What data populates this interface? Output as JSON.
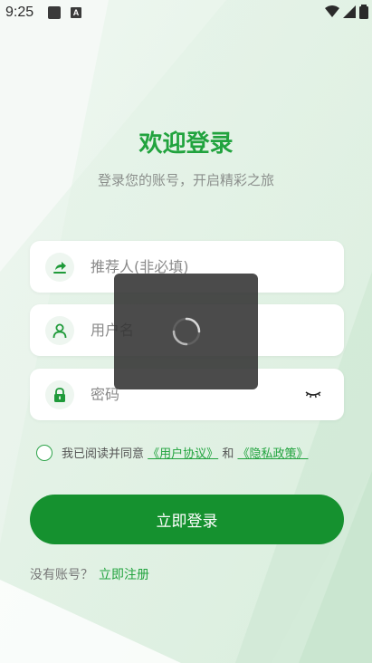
{
  "status_bar": {
    "time": "9:25",
    "app_icon_letter": "A"
  },
  "header": {
    "title": "欢迎登录",
    "subtitle": "登录您的账号，开启精彩之旅"
  },
  "form": {
    "referrer": {
      "placeholder": "推荐人(非必填)",
      "value": "",
      "icon": "share-icon"
    },
    "username": {
      "placeholder": "用户名",
      "value": "",
      "icon": "user-icon"
    },
    "password": {
      "placeholder": "密码",
      "value": "",
      "icon": "lock-icon",
      "toggle_icon": "eye-closed-icon"
    }
  },
  "agreement": {
    "prefix": "我已阅读并同意",
    "user_agreement": "《用户协议》",
    "connector": "和",
    "privacy_policy": "《隐私政策》",
    "checked": false
  },
  "login_button": {
    "label": "立即登录"
  },
  "register": {
    "prompt": "没有账号？",
    "link": "立即注册"
  },
  "loading": {
    "visible": true
  },
  "colors": {
    "accent": "#21a33e",
    "button": "#15912f",
    "overlay": "#323232"
  }
}
